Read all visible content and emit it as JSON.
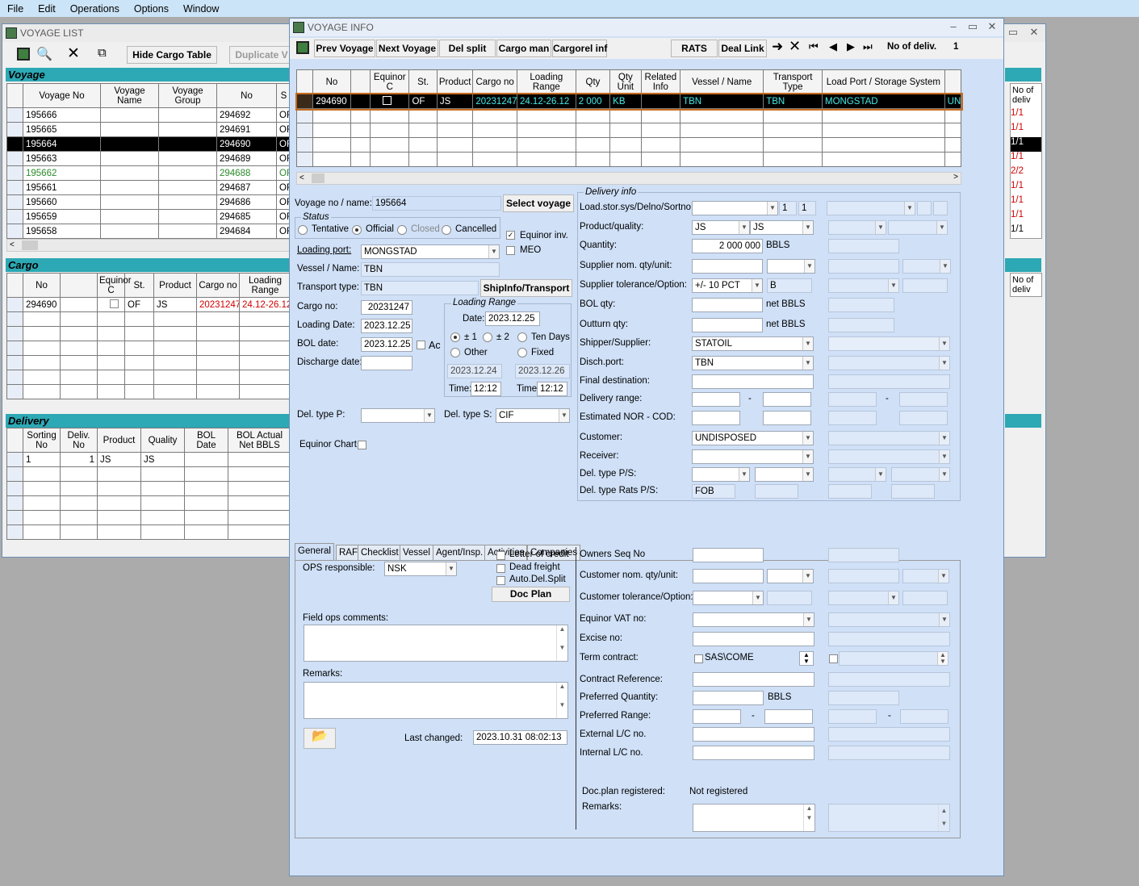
{
  "menu": [
    "File",
    "Edit",
    "Operations",
    "Options",
    "Window"
  ],
  "vl": {
    "title": "VOYAGE LIST",
    "hide_btn": "Hide Cargo Table",
    "dup_btn": "Duplicate V",
    "voyage_band": "Voyage",
    "voyage_cols": [
      "Voyage No",
      "Voyage Name",
      "Voyage Group",
      "No",
      "S"
    ],
    "voyage_rows": [
      [
        "195666",
        "294692",
        "OF"
      ],
      [
        "195665",
        "294691",
        "OF"
      ],
      [
        "195664",
        "294690",
        "OF"
      ],
      [
        "195663",
        "294689",
        "OF"
      ],
      [
        "195662",
        "294688",
        "OF"
      ],
      [
        "195661",
        "294687",
        "OF"
      ],
      [
        "195660",
        "294686",
        "OF"
      ],
      [
        "195659",
        "294685",
        "OF"
      ],
      [
        "195658",
        "294684",
        "OF"
      ]
    ],
    "cargo_band": "Cargo",
    "cargo_cols": [
      "No",
      "Equinor C",
      "St.",
      "Product",
      "Cargo no",
      "Loading Range"
    ],
    "cargo_row": [
      "294690",
      "OF",
      "JS",
      "20231247",
      "24.12-26.12"
    ],
    "delivery_band": "Delivery",
    "delivery_cols": [
      "Sorting No",
      "Deliv. No",
      "Product",
      "Quality",
      "BOL Date",
      "BOL Actual Net BBLS"
    ],
    "delivery_row": [
      "1",
      "1",
      "JS",
      "JS"
    ],
    "right_col_head": "No of deliv",
    "right_col_vals": [
      "1/1",
      "1/1",
      "1/1",
      "1/1",
      "2/2",
      "1/1",
      "1/1",
      "1/1",
      "1/1"
    ]
  },
  "vi": {
    "title": "VOYAGE INFO",
    "toolbar": {
      "prev": "Prev Voyage",
      "next": "Next Voyage",
      "del_split": "Del split",
      "cargo_man": "Cargo man",
      "cargorel": "Cargorel inf",
      "rats": "RATS",
      "deal_link": "Deal Link",
      "no_deliv_label": "No of deliv.",
      "no_deliv_val": "1"
    },
    "grid_cols": [
      "No",
      "Equinor C",
      "St.",
      "Product",
      "Cargo no",
      "Loading Range",
      "Qty",
      "Qty Unit",
      "Related Info",
      "Vessel / Name",
      "Transport Type",
      "Load Port / Storage System"
    ],
    "grid_row": [
      "294690",
      "OF",
      "JS",
      "20231247",
      "24.12-26.12",
      "2 000",
      "KB",
      "",
      "TBN",
      "TBN",
      "MONGSTAD",
      "UN"
    ],
    "left": {
      "voyage_label": "Voyage no / name:",
      "voyage_val": "195664",
      "select_btn": "Select voyage",
      "status_title": "Status",
      "status_opts": [
        "Tentative",
        "Official",
        "Closed",
        "Cancelled"
      ],
      "equinor_inv": "Equinor inv.",
      "meo": "MEO",
      "loading_port_label": "Loading port:",
      "loading_port": "MONGSTAD",
      "vessel_label": "Vessel / Name:",
      "vessel": "TBN",
      "transport_label": "Transport type:",
      "transport": "TBN",
      "shipinfo_btn": "ShipInfo/Transport",
      "cargo_no_label": "Cargo no:",
      "cargo_no": "20231247",
      "loading_date_label": "Loading Date:",
      "loading_date": "2023.12.25",
      "bol_date_label": "BOL date:",
      "bol_date": "2023.12.25",
      "ac": "Ac",
      "discharge_label": "Discharge date:",
      "lr_title": "Loading Range",
      "lr_date_label": "Date:",
      "lr_date": "2023.12.25",
      "lr_opts": [
        "± 1",
        "± 2",
        "Ten Days",
        "Other",
        "Fixed"
      ],
      "lr_from": "2023.12.24",
      "lr_to": "2023.12.26",
      "time_label": "Time:",
      "time1": "12:12",
      "time2": "12:12",
      "del_p_label": "Del. type P:",
      "del_s_label": "Del. type S:",
      "del_s": "CIF",
      "equinor_chart": "Equinor Chart."
    },
    "delivery": {
      "title": "Delivery info",
      "load_stor_label": "Load.stor.sys/Delno/Sortno:",
      "delno": "1",
      "sortno": "1",
      "product_label": "Product/quality:",
      "product": "JS",
      "quality": "JS",
      "quantity_label": "Quantity:",
      "quantity": "2 000 000",
      "qty_unit": "BBLS",
      "supplier_nom_label": "Supplier nom. qty/unit:",
      "supplier_tol_label": "Supplier tolerance/Option:",
      "supplier_tol": "+/- 10 PCT",
      "supplier_opt": "B",
      "bol_qty_label": "BOL qty:",
      "bol_qty_unit": "net BBLS",
      "outturn_label": "Outturn qty:",
      "outturn_unit": "net BBLS",
      "shipper_label": "Shipper/Supplier:",
      "shipper": "STATOIL",
      "disch_label": "Disch.port:",
      "disch": "TBN",
      "final_dest_label": "Final destination:",
      "delivery_range_label": "Delivery range:",
      "dash": "-",
      "nor_label": "Estimated NOR - COD:",
      "customer_label": "Customer:",
      "customer": "UNDISPOSED",
      "receiver_label": "Receiver:",
      "del_type_label": "Del. type P/S:",
      "del_type_rats_label": "Del. type Rats P/S:",
      "del_type_rats": "FOB"
    },
    "tabs": [
      "General",
      "RAF",
      "Checklist",
      "Vessel",
      "Agent/Insp.",
      "Activities",
      "Companies"
    ],
    "general": {
      "ops_label": "OPS responsible:",
      "ops": "NSK",
      "letter_credit": "Letter of credit",
      "dead_freight": "Dead freight",
      "auto_del": "Auto.Del.Split",
      "doc_plan": "Doc Plan",
      "field_ops_label": "Field ops comments:",
      "remarks_label": "Remarks:",
      "last_changed_label": "Last changed:",
      "last_changed": "2023.10.31 08:02:13"
    },
    "general_right": {
      "owners_seq": "Owners Seq No",
      "cust_nom": "Customer nom. qty/unit:",
      "cust_tol": "Customer tolerance/Option:",
      "vat": "Equinor VAT no:",
      "excise": "Excise no:",
      "term": "Term contract:",
      "term_val": "SAS\\COME",
      "contract_ref": "Contract Reference:",
      "pref_qty": "Preferred Quantity:",
      "pref_unit": "BBLS",
      "pref_range": "Preferred Range:",
      "ext_lc": "External L/C no.",
      "int_lc": "Internal  L/C no.",
      "docplan_reg_label": "Doc.plan registered:",
      "docplan_reg": "Not registered",
      "remarks": "Remarks:"
    }
  }
}
